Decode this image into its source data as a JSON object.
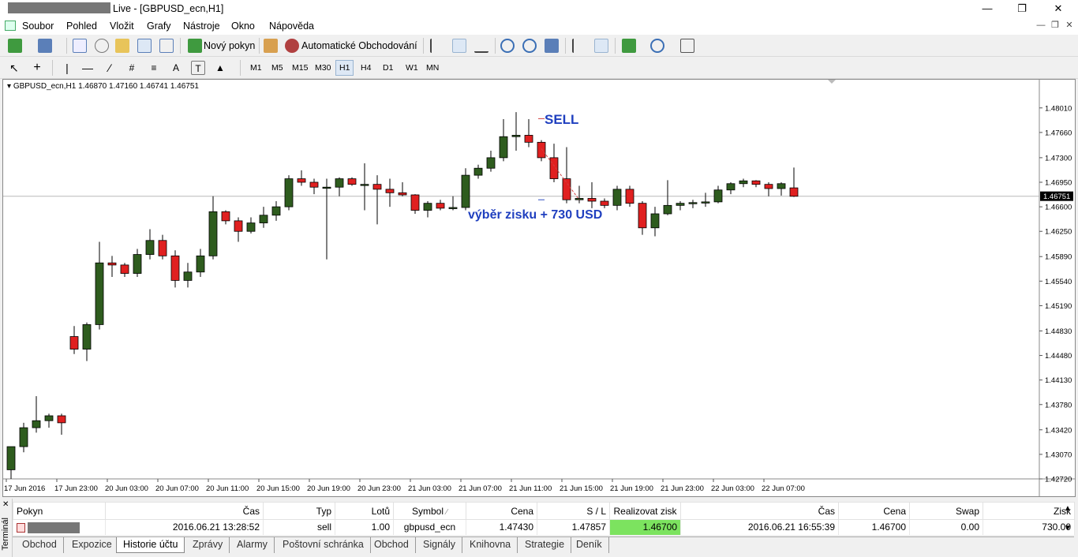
{
  "window": {
    "title": "Live - [GBPUSD_ecn,H1]",
    "title_visible": "Live - [GBPUSD_ecn,H1]"
  },
  "menu": [
    "Soubor",
    "Pohled",
    "Vložit",
    "Grafy",
    "Nástroje",
    "Okno",
    "Nápověda"
  ],
  "toolbar": {
    "new_order": "Nový pokyn",
    "auto_trading": "Automatické Obchodování",
    "timeframes": [
      "M1",
      "M5",
      "M15",
      "M30",
      "H1",
      "H4",
      "D1",
      "W1",
      "MN"
    ],
    "active_timeframe": "H1"
  },
  "chart": {
    "header": "GBPUSD_ecn,H1  1.46870 1.47160 1.46741 1.46751",
    "sell_label": "SELL",
    "profit_label": "výběr zisku + 730 USD",
    "current_price": "1.46751",
    "bull_color": "#2e5c1e",
    "bear_color": "#e02020",
    "annotation_color": "#1f3fbf"
  },
  "chart_data": {
    "type": "candlestick",
    "symbol": "GBPUSD_ecn",
    "timeframe": "H1",
    "y_ticks": [
      "1.48010",
      "1.47660",
      "1.47300",
      "1.46950",
      "1.46600",
      "1.46250",
      "1.45890",
      "1.45540",
      "1.45190",
      "1.44830",
      "1.44480",
      "1.44130",
      "1.43780",
      "1.43420",
      "1.43070",
      "1.42720"
    ],
    "x_ticks": [
      "17 Jun 2016",
      "17 Jun 23:00",
      "20 Jun 03:00",
      "20 Jun 07:00",
      "20 Jun 11:00",
      "20 Jun 15:00",
      "20 Jun 19:00",
      "20 Jun 23:00",
      "21 Jun 03:00",
      "21 Jun 07:00",
      "21 Jun 11:00",
      "21 Jun 15:00",
      "21 Jun 19:00",
      "21 Jun 23:00",
      "22 Jun 03:00",
      "22 Jun 07:00"
    ],
    "ylim": [
      1.4272,
      1.483
    ],
    "candles": [
      [
        1.4285,
        1.4318,
        1.4272,
        1.4318
      ],
      [
        1.4318,
        1.4352,
        1.431,
        1.4345
      ],
      [
        1.4345,
        1.439,
        1.4338,
        1.4355
      ],
      [
        1.4355,
        1.4365,
        1.4345,
        1.4362
      ],
      [
        1.4362,
        1.4365,
        1.4335,
        1.4352
      ],
      [
        1.4475,
        1.449,
        1.445,
        1.4457
      ],
      [
        1.4457,
        1.4495,
        1.444,
        1.4492
      ],
      [
        1.4492,
        1.461,
        1.4485,
        1.458
      ],
      [
        1.458,
        1.459,
        1.456,
        1.4577
      ],
      [
        1.4577,
        1.458,
        1.456,
        1.4565
      ],
      [
        1.4565,
        1.46,
        1.456,
        1.4592
      ],
      [
        1.4592,
        1.4628,
        1.4585,
        1.4612
      ],
      [
        1.4612,
        1.462,
        1.4585,
        1.459
      ],
      [
        1.459,
        1.4598,
        1.4545,
        1.4555
      ],
      [
        1.4555,
        1.458,
        1.4545,
        1.4567
      ],
      [
        1.4567,
        1.46,
        1.456,
        1.459
      ],
      [
        1.459,
        1.4675,
        1.4585,
        1.4653
      ],
      [
        1.4653,
        1.4655,
        1.4635,
        1.464
      ],
      [
        1.464,
        1.4645,
        1.461,
        1.4625
      ],
      [
        1.4625,
        1.4645,
        1.4622,
        1.4637
      ],
      [
        1.4637,
        1.466,
        1.463,
        1.4648
      ],
      [
        1.4648,
        1.4668,
        1.464,
        1.466
      ],
      [
        1.466,
        1.4705,
        1.4655,
        1.47
      ],
      [
        1.47,
        1.4712,
        1.469,
        1.4695
      ],
      [
        1.4695,
        1.47,
        1.4678,
        1.4688
      ],
      [
        1.4688,
        1.47,
        1.4585,
        1.4688
      ],
      [
        1.4688,
        1.4702,
        1.4675,
        1.47
      ],
      [
        1.47,
        1.4702,
        1.469,
        1.4692
      ],
      [
        1.4692,
        1.4722,
        1.4655,
        1.4692
      ],
      [
        1.4692,
        1.4705,
        1.4635,
        1.4685
      ],
      [
        1.4685,
        1.47,
        1.466,
        1.468
      ],
      [
        1.468,
        1.4695,
        1.4675,
        1.4677
      ],
      [
        1.4677,
        1.4678,
        1.465,
        1.4655
      ],
      [
        1.4655,
        1.4668,
        1.4645,
        1.4665
      ],
      [
        1.4665,
        1.467,
        1.4655,
        1.4658
      ],
      [
        1.4658,
        1.4675,
        1.4655,
        1.4659
      ],
      [
        1.4659,
        1.4715,
        1.4655,
        1.4705
      ],
      [
        1.4705,
        1.472,
        1.47,
        1.4715
      ],
      [
        1.4715,
        1.474,
        1.471,
        1.473
      ],
      [
        1.473,
        1.4785,
        1.4725,
        1.476
      ],
      [
        1.476,
        1.4795,
        1.474,
        1.4762
      ],
      [
        1.4762,
        1.4785,
        1.4745,
        1.4752
      ],
      [
        1.4752,
        1.4755,
        1.4725,
        1.473
      ],
      [
        1.473,
        1.475,
        1.4695,
        1.47
      ],
      [
        1.47,
        1.4745,
        1.4665,
        1.467
      ],
      [
        1.467,
        1.469,
        1.4665,
        1.4672
      ],
      [
        1.4672,
        1.4695,
        1.4658,
        1.4668
      ],
      [
        1.4668,
        1.4672,
        1.4658,
        1.4662
      ],
      [
        1.4662,
        1.469,
        1.4655,
        1.4685
      ],
      [
        1.4685,
        1.469,
        1.466,
        1.4665
      ],
      [
        1.4665,
        1.4668,
        1.462,
        1.463
      ],
      [
        1.463,
        1.466,
        1.4618,
        1.465
      ],
      [
        1.465,
        1.4698,
        1.4648,
        1.4662
      ],
      [
        1.4662,
        1.4668,
        1.4655,
        1.4665
      ],
      [
        1.4665,
        1.467,
        1.4658,
        1.4666
      ],
      [
        1.4666,
        1.468,
        1.466,
        1.4667
      ],
      [
        1.4667,
        1.469,
        1.4665,
        1.4684
      ],
      [
        1.4684,
        1.4695,
        1.4678,
        1.4693
      ],
      [
        1.4693,
        1.47,
        1.4688,
        1.4697
      ],
      [
        1.4697,
        1.4698,
        1.4688,
        1.4692
      ],
      [
        1.4692,
        1.4695,
        1.4675,
        1.4686
      ],
      [
        1.4686,
        1.4695,
        1.4676,
        1.4693
      ],
      [
        1.4687,
        1.4716,
        1.4674,
        1.4675
      ]
    ],
    "sell_price": 1.4743,
    "sl_price": 1.47857,
    "tp_price": 1.467,
    "current_line": 1.46751
  },
  "terminal": {
    "label": "Terminál",
    "columns": [
      "Pokyn",
      "Čas",
      "Typ",
      "Lotů",
      "Symbol",
      "Cena",
      "S / L",
      "Realizovat zisk",
      "Čas",
      "Cena",
      "Swap",
      "Zisk"
    ],
    "row": {
      "time_open": "2016.06.21 13:28:52",
      "type": "sell",
      "lots": "1.00",
      "symbol": "gbpusd_ecn",
      "price_open": "1.47430",
      "sl": "1.47857",
      "tp": "1.46700",
      "time_close": "2016.06.21 16:55:39",
      "price_close": "1.46700",
      "swap": "0.00",
      "profit": "730.00"
    },
    "tabs": [
      "Obchod",
      "Expozice",
      "Historie účtu",
      "Zprávy",
      "Alarmy",
      "Poštovní schránka",
      "Obchod",
      "Signály",
      "Knihovna",
      "Strategie",
      "Deník"
    ],
    "active_tab": "Historie účtu"
  }
}
